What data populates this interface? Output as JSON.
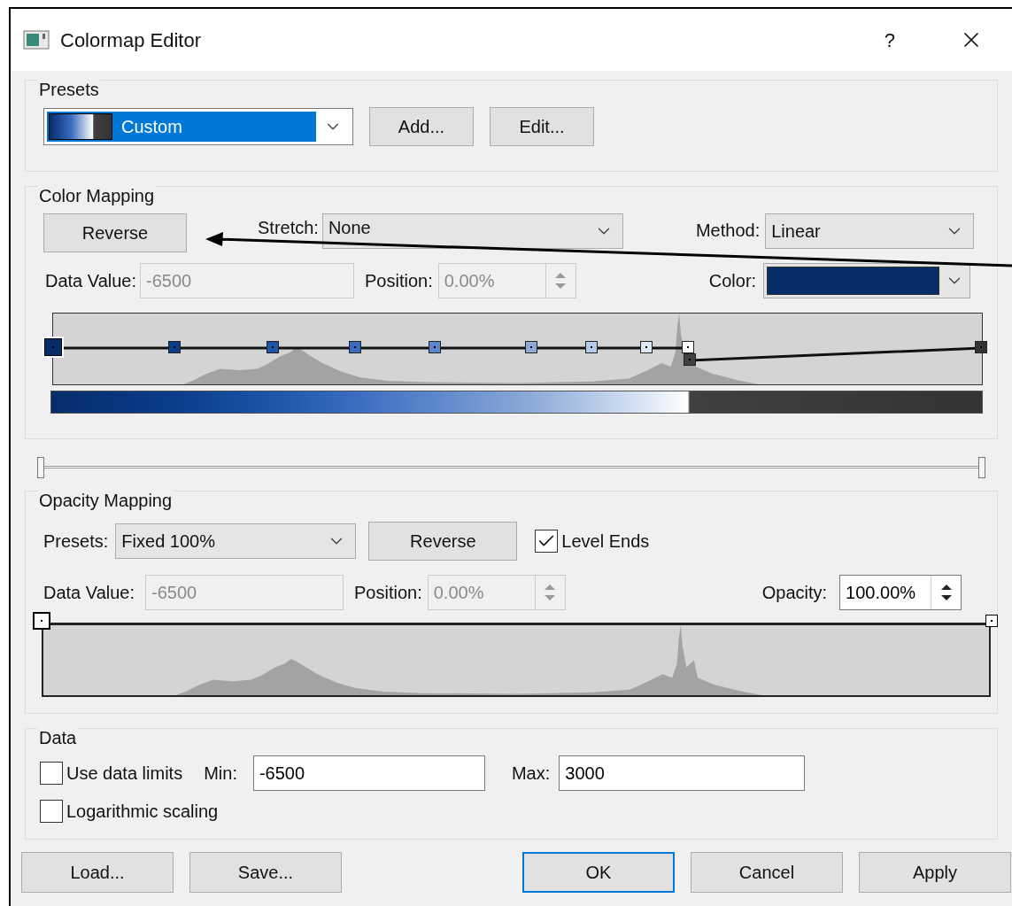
{
  "window": {
    "title": "Colormap Editor",
    "help": "?"
  },
  "presets": {
    "label": "Presets",
    "value": "Custom",
    "buttons": [
      "Add...",
      "Edit..."
    ]
  },
  "color_mapping": {
    "label": "Color Mapping",
    "reverse": "Reverse",
    "stretch_label": "Stretch:",
    "stretch": "None",
    "method_label": "Method:",
    "method": "Linear",
    "data_value_label": "Data Value:",
    "data_value": {
      "value": "-6500",
      "disabled": true
    },
    "position_label": "Position:",
    "position": {
      "value": "0.00%",
      "disabled": true
    },
    "color_label": "Color:",
    "color": "#062d6a",
    "stops": [
      {
        "kind": "node",
        "color": "#062d6a",
        "selected": true
      },
      {
        "kind": "node",
        "color": "#0a3c8a",
        "selected": false
      },
      {
        "kind": "node",
        "color": "#1d55a8",
        "selected": false
      },
      {
        "kind": "node",
        "color": "#3a6cc0",
        "selected": false
      },
      {
        "kind": "node",
        "color": "#5d87cc",
        "selected": false
      },
      {
        "kind": "node",
        "color": "#8daad9",
        "selected": false
      },
      {
        "kind": "node",
        "color": "#b5c9e8",
        "selected": false
      },
      {
        "kind": "node",
        "color": "#dde7f5",
        "selected": false
      },
      {
        "kind": "node",
        "color": "#ffffff",
        "selected": false
      },
      {
        "kind": "step",
        "color": "#404040",
        "selected": false
      },
      {
        "kind": "node",
        "color": "#333333",
        "selected": false
      }
    ]
  },
  "range_slider": {
    "low": {
      "level": 0
    },
    "high": {
      "level": 1
    }
  },
  "opacity_mapping": {
    "label": "Opacity Mapping",
    "presets_label": "Presets:",
    "presets": "Fixed 100%",
    "reverse": "Reverse",
    "level_ends": {
      "label": "Level Ends",
      "checked": true
    },
    "data_value_label": "Data Value:",
    "data_value": {
      "value": "-6500",
      "disabled": true
    },
    "position_label": "Position:",
    "position": {
      "value": "0.00%",
      "disabled": true
    },
    "opacity_label": "Opacity:",
    "opacity": "100.00%"
  },
  "data": {
    "label": "Data",
    "use_data_limits": {
      "label": "Use data limits",
      "checked": false
    },
    "min_label": "Min:",
    "min": "-6500",
    "max_label": "Max:",
    "max": "3000",
    "logarithmic": {
      "label": "Logarithmic scaling",
      "checked": false
    }
  },
  "buttons": [
    {
      "label": "Load...",
      "default": false
    },
    {
      "label": "Save...",
      "default": false
    },
    {
      "label": "OK",
      "default": true
    },
    {
      "label": "Cancel",
      "default": false
    },
    {
      "label": "Apply",
      "default": false
    }
  ]
}
